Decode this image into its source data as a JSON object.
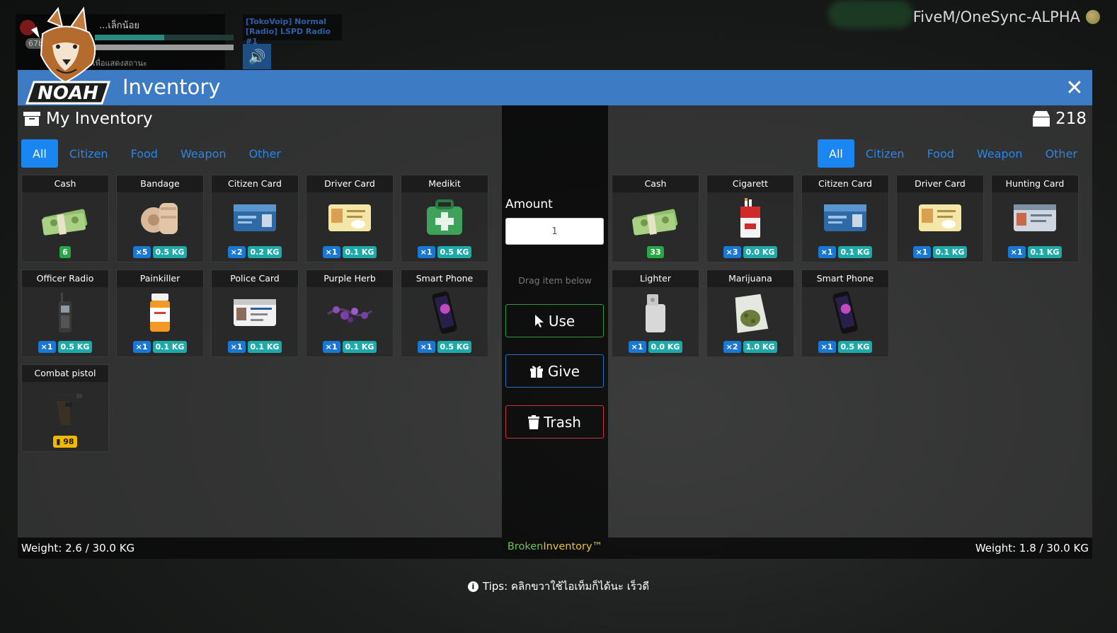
{
  "hud": {
    "player_name": "...เล็กน้อย",
    "badge": "67b",
    "status": "ก...(1) ค้างไว้เพื่อแสดงสถานะ",
    "health_fraction": 0.5,
    "armor_fraction": 1.0
  },
  "voip": {
    "line1": "[TokoVoip] Normal",
    "line2": "[Radio] LSPD Radio #1"
  },
  "server_tag": "FiveM/OneSync-ALPHA",
  "logo_text": "NOAH",
  "window": {
    "title": "Inventory",
    "close_label": "✕"
  },
  "left_panel": {
    "title": "My Inventory",
    "tabs": [
      "All",
      "Citizen",
      "Food",
      "Weapon",
      "Other"
    ],
    "active_tab": "All",
    "weight": "Weight: 2.6 / 30.0 KG",
    "items": [
      {
        "name": "Cash",
        "icon": "cash-icon",
        "count": "6",
        "weight": ""
      },
      {
        "name": "Bandage",
        "icon": "bandage-icon",
        "count": "×5",
        "weight": "0.5 KG"
      },
      {
        "name": "Citizen Card",
        "icon": "citizen-card-icon",
        "count": "×2",
        "weight": "0.2 KG"
      },
      {
        "name": "Driver Card",
        "icon": "driver-card-icon",
        "count": "×1",
        "weight": "0.1 KG"
      },
      {
        "name": "Medikit",
        "icon": "medikit-icon",
        "count": "×1",
        "weight": "0.5 KG"
      },
      {
        "name": "Officer Radio",
        "icon": "radio-icon",
        "count": "×1",
        "weight": "0.5 KG"
      },
      {
        "name": "Painkiller",
        "icon": "pill-bottle-icon",
        "count": "×1",
        "weight": "0.1 KG"
      },
      {
        "name": "Police Card",
        "icon": "police-card-icon",
        "count": "×1",
        "weight": "0.1 KG"
      },
      {
        "name": "Purple Herb",
        "icon": "herb-icon",
        "count": "×1",
        "weight": "0.1 KG"
      },
      {
        "name": "Smart Phone",
        "icon": "phone-icon",
        "count": "×1",
        "weight": "0.5 KG"
      },
      {
        "name": "Combat pistol",
        "icon": "pistol-icon",
        "count": "",
        "weight": "",
        "ammo": "98"
      }
    ]
  },
  "middle_panel": {
    "amount_label": "Amount",
    "amount_value": "1",
    "drag_hint": "Drag item below",
    "use_label": "Use",
    "give_label": "Give",
    "trash_label": "Trash",
    "brand_part1": "Broken",
    "brand_part2": "Inventory™"
  },
  "right_panel": {
    "count": "218",
    "tabs": [
      "All",
      "Citizen",
      "Food",
      "Weapon",
      "Other"
    ],
    "active_tab": "All",
    "weight": "Weight: 1.8 / 30.0 KG",
    "items": [
      {
        "name": "Cash",
        "icon": "cash-icon",
        "count": "33",
        "weight": ""
      },
      {
        "name": "Cigarett",
        "icon": "cigarette-pack-icon",
        "count": "×3",
        "weight": "0.0 KG"
      },
      {
        "name": "Citizen Card",
        "icon": "citizen-card-icon",
        "count": "×1",
        "weight": "0.1 KG"
      },
      {
        "name": "Driver Card",
        "icon": "driver-card-icon",
        "count": "×1",
        "weight": "0.1 KG"
      },
      {
        "name": "Hunting Card",
        "icon": "hunting-card-icon",
        "count": "×1",
        "weight": "0.1 KG"
      },
      {
        "name": "Lighter",
        "icon": "lighter-icon",
        "count": "×1",
        "weight": "0.0 KG"
      },
      {
        "name": "Marijuana",
        "icon": "marijuana-bag-icon",
        "count": "×2",
        "weight": "1.0 KG"
      },
      {
        "name": "Smart Phone",
        "icon": "phone-icon",
        "count": "×1",
        "weight": "0.5 KG"
      }
    ]
  },
  "tips": "Tips: คลิกขวาใช้ไอเท็มก็ได้นะ เร็วดี",
  "colors": {
    "titlebar": "#3d7cc4",
    "tab_active": "#1a86f2",
    "count_badge": "#1a78d2",
    "weight_badge": "#1fa9a9",
    "cash_badge": "#27a844",
    "ammo_badge": "#f0b800"
  }
}
